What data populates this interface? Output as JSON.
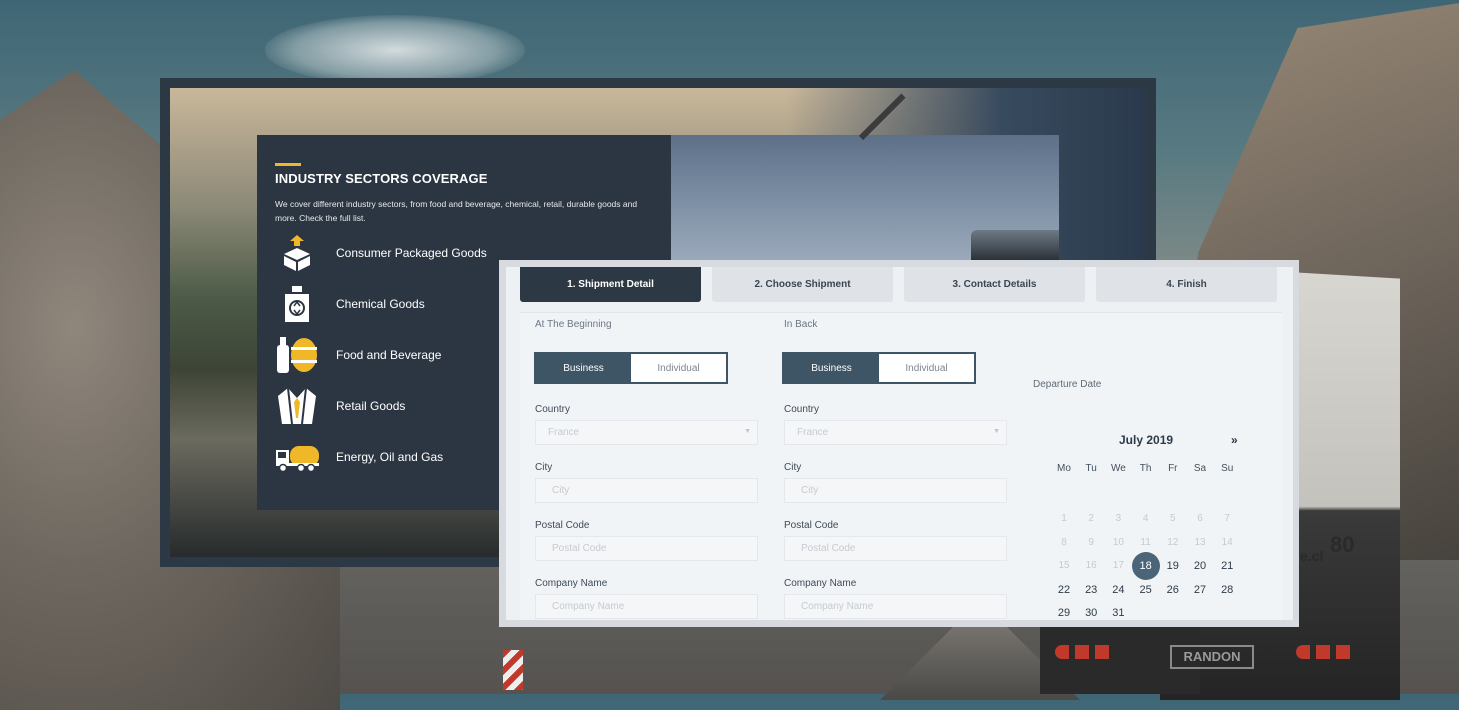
{
  "industry": {
    "title": "INDUSTRY SECTORS COVERAGE",
    "description": "We cover different industry sectors, from food and beverage, chemical, retail, durable goods and more. Check the full list.",
    "sectors": [
      {
        "label": "Consumer Packaged Goods",
        "icon": "package-icon"
      },
      {
        "label": "Chemical Goods",
        "icon": "chemical-bottle-icon"
      },
      {
        "label": "Food and Beverage",
        "icon": "bottle-barrel-icon"
      },
      {
        "label": "Retail Goods",
        "icon": "shirt-tie-icon"
      },
      {
        "label": "Energy, Oil and Gas",
        "icon": "tanker-truck-icon"
      }
    ],
    "accent_color": "#f0b829"
  },
  "form": {
    "tabs": [
      {
        "label": "1. Shipment Detail",
        "active": true
      },
      {
        "label": "2. Choose Shipment",
        "active": false
      },
      {
        "label": "3. Contact Details",
        "active": false
      },
      {
        "label": "4. Finish",
        "active": false
      }
    ],
    "columns": [
      {
        "title": "At The Beginning",
        "toggle": {
          "selected": "Business",
          "other": "Individual"
        },
        "fields": {
          "country_label": "Country",
          "country_value": "France",
          "city_label": "City",
          "city_placeholder": "City",
          "postal_label": "Postal Code",
          "postal_placeholder": "Postal Code",
          "company_label": "Company Name",
          "company_placeholder": "Company Name"
        }
      },
      {
        "title": "In Back",
        "toggle": {
          "selected": "Business",
          "other": "Individual"
        },
        "fields": {
          "country_label": "Country",
          "country_value": "France",
          "city_label": "City",
          "city_placeholder": "City",
          "postal_label": "Postal Code",
          "postal_placeholder": "Postal Code",
          "company_label": "Company Name",
          "company_placeholder": "Company Name"
        }
      }
    ],
    "departure_label": "Departure Date",
    "calendar": {
      "month": "July 2019",
      "next": "»",
      "weekdays": [
        "Mo",
        "Tu",
        "We",
        "Th",
        "Fr",
        "Sa",
        "Su"
      ],
      "weeks": [
        [
          "1",
          "2",
          "3",
          "4",
          "5",
          "6",
          "7"
        ],
        [
          "8",
          "9",
          "10",
          "11",
          "12",
          "13",
          "14"
        ],
        [
          "15",
          "16",
          "17",
          "18",
          "19",
          "20",
          "21"
        ],
        [
          "22",
          "23",
          "24",
          "25",
          "26",
          "27",
          "28"
        ],
        [
          "29",
          "30",
          "31"
        ]
      ],
      "selected_day": "18",
      "disabled_before": "18"
    },
    "primary_color": "#2c3944",
    "toggle_color": "#3e5566"
  },
  "background": {
    "truck_number": "80",
    "truck_plate": "RANDON",
    "truck_text": "e.cl"
  }
}
